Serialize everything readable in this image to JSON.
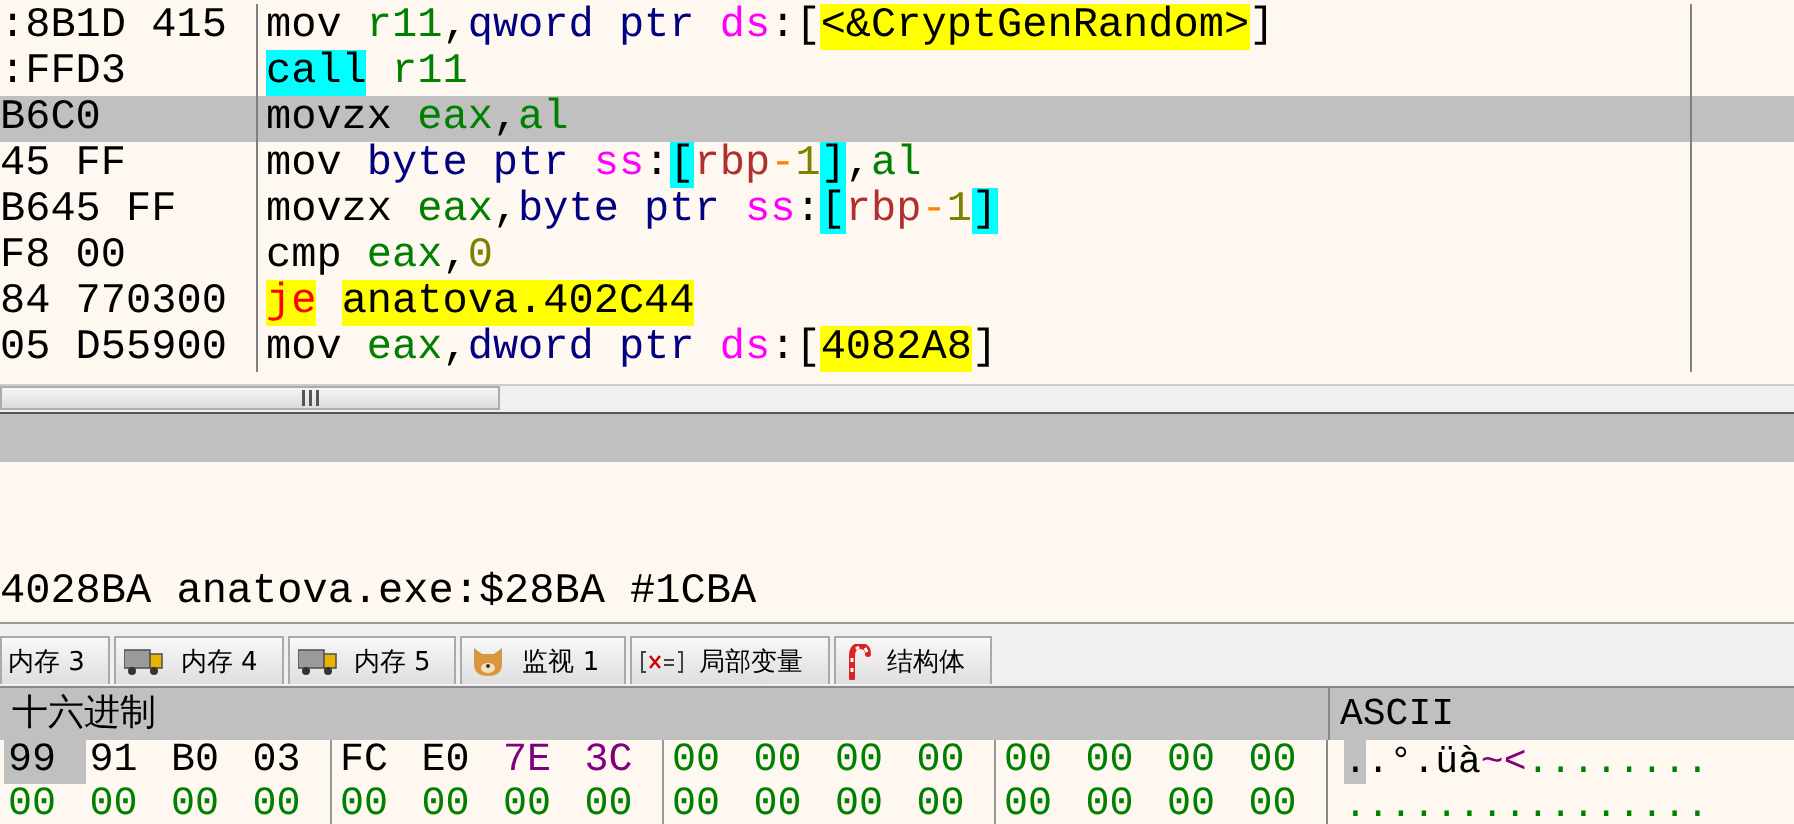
{
  "disassembly": {
    "rows": [
      {
        "bytes": ":8B1D 415",
        "selected": false,
        "instruction": [
          {
            "text": "mov ",
            "kind": "mnem"
          },
          {
            "text": "r11",
            "kind": "reg"
          },
          {
            "text": ",",
            "kind": "punct"
          },
          {
            "text": "qword ptr ",
            "kind": "size"
          },
          {
            "text": "ds",
            "kind": "seg"
          },
          {
            "text": ":",
            "kind": "punct"
          },
          {
            "text": "[",
            "kind": "punct"
          },
          {
            "text": "<&CryptGenRandom>",
            "kind": "addr",
            "highlighted": true
          },
          {
            "text": "]",
            "kind": "punct"
          }
        ]
      },
      {
        "bytes": ":FFD3",
        "selected": false,
        "instruction": [
          {
            "text": "call",
            "kind": "mnem",
            "highlighted": true
          },
          {
            "text": " r11",
            "kind": "reg"
          }
        ]
      },
      {
        "bytes": "B6C0",
        "selected": true,
        "instruction": [
          {
            "text": "movzx ",
            "kind": "mnem"
          },
          {
            "text": "eax",
            "kind": "reg"
          },
          {
            "text": ",",
            "kind": "punct"
          },
          {
            "text": "al",
            "kind": "reg"
          }
        ]
      },
      {
        "bytes": "45 FF",
        "selected": false,
        "instruction": [
          {
            "text": "mov ",
            "kind": "mnem"
          },
          {
            "text": "byte ptr ",
            "kind": "size"
          },
          {
            "text": "ss",
            "kind": "seg"
          },
          {
            "text": ":",
            "kind": "punct"
          },
          {
            "text": "[",
            "kind": "punct",
            "highlighted": true
          },
          {
            "text": "rbp",
            "kind": "base"
          },
          {
            "text": "-",
            "kind": "op"
          },
          {
            "text": "1",
            "kind": "num"
          },
          {
            "text": "]",
            "kind": "punct",
            "highlighted": true
          },
          {
            "text": ",",
            "kind": "punct"
          },
          {
            "text": "al",
            "kind": "reg"
          }
        ]
      },
      {
        "bytes": "B645 FF",
        "selected": false,
        "instruction": [
          {
            "text": "movzx ",
            "kind": "mnem"
          },
          {
            "text": "eax",
            "kind": "reg"
          },
          {
            "text": ",",
            "kind": "punct"
          },
          {
            "text": "byte ptr ",
            "kind": "size"
          },
          {
            "text": "ss",
            "kind": "seg"
          },
          {
            "text": ":",
            "kind": "punct"
          },
          {
            "text": "[",
            "kind": "punct",
            "highlighted": true
          },
          {
            "text": "rbp",
            "kind": "base"
          },
          {
            "text": "-",
            "kind": "op"
          },
          {
            "text": "1",
            "kind": "num"
          },
          {
            "text": "]",
            "kind": "punct",
            "highlighted": true
          }
        ]
      },
      {
        "bytes": "F8 00",
        "selected": false,
        "instruction": [
          {
            "text": "cmp ",
            "kind": "mnem"
          },
          {
            "text": "eax",
            "kind": "reg"
          },
          {
            "text": ",",
            "kind": "punct"
          },
          {
            "text": "0",
            "kind": "num"
          }
        ]
      },
      {
        "bytes": "84 770300",
        "selected": false,
        "instruction": [
          {
            "text": "je",
            "kind": "jump",
            "highlighted": true
          },
          {
            "text": " anatova.402C44",
            "kind": "addr",
            "highlighted": true
          }
        ]
      },
      {
        "bytes": "05 D55900",
        "selected": false,
        "instruction": [
          {
            "text": "mov ",
            "kind": "mnem"
          },
          {
            "text": "eax",
            "kind": "reg"
          },
          {
            "text": ",",
            "kind": "punct"
          },
          {
            "text": "dword ptr ",
            "kind": "size"
          },
          {
            "text": "ds",
            "kind": "seg"
          },
          {
            "text": ":",
            "kind": "punct"
          },
          {
            "text": "[",
            "kind": "punct"
          },
          {
            "text": "4082A8",
            "kind": "addr",
            "highlighted": true
          },
          {
            "text": "]",
            "kind": "punct"
          }
        ]
      }
    ]
  },
  "info": {
    "text": "4028BA anatova.exe:$28BA #1CBA"
  },
  "tabs": [
    {
      "label": "内存 3",
      "kind": "plain",
      "selected": false
    },
    {
      "label": "内存 4",
      "kind": "memory",
      "selected": false
    },
    {
      "label": "内存 5",
      "kind": "memory",
      "selected": false
    },
    {
      "label": "监视 1",
      "kind": "watch",
      "selected": false
    },
    {
      "label": "局部变量",
      "kind": "locals",
      "selected": false
    },
    {
      "label": "结构体",
      "kind": "struct",
      "selected": false
    }
  ],
  "dump": {
    "hex_header": "十六进制",
    "ascii_header": "ASCII",
    "rows": [
      {
        "bytes": [
          {
            "v": "99",
            "kind": "other",
            "selected": true
          },
          {
            "v": "91",
            "kind": "other",
            "selected": false
          },
          {
            "v": "B0",
            "kind": "other",
            "selected": false
          },
          {
            "v": "03",
            "kind": "other",
            "selected": false
          },
          {
            "v": "FC",
            "kind": "other",
            "selected": false
          },
          {
            "v": "E0",
            "kind": "other",
            "selected": false
          },
          {
            "v": "7E",
            "kind": "printable",
            "selected": false
          },
          {
            "v": "3C",
            "kind": "printable",
            "selected": false
          },
          {
            "v": "00",
            "kind": "zero",
            "selected": false
          },
          {
            "v": "00",
            "kind": "zero",
            "selected": false
          },
          {
            "v": "00",
            "kind": "zero",
            "selected": false
          },
          {
            "v": "00",
            "kind": "zero",
            "selected": false
          },
          {
            "v": "00",
            "kind": "zero",
            "selected": false
          },
          {
            "v": "00",
            "kind": "zero",
            "selected": false
          },
          {
            "v": "00",
            "kind": "zero",
            "selected": false
          },
          {
            "v": "00",
            "kind": "zero",
            "selected": false
          }
        ],
        "ascii": [
          {
            "text": ".",
            "kind": "other",
            "selected": true
          },
          {
            "text": ".°.üà",
            "kind": "other",
            "selected": false
          },
          {
            "text": "~<",
            "kind": "printable",
            "selected": false
          },
          {
            "text": "........",
            "kind": "zero",
            "selected": false
          }
        ]
      },
      {
        "bytes": [
          {
            "v": "00",
            "kind": "zero",
            "selected": false
          },
          {
            "v": "00",
            "kind": "zero",
            "selected": false
          },
          {
            "v": "00",
            "kind": "zero",
            "selected": false
          },
          {
            "v": "00",
            "kind": "zero",
            "selected": false
          },
          {
            "v": "00",
            "kind": "zero",
            "selected": false
          },
          {
            "v": "00",
            "kind": "zero",
            "selected": false
          },
          {
            "v": "00",
            "kind": "zero",
            "selected": false
          },
          {
            "v": "00",
            "kind": "zero",
            "selected": false
          },
          {
            "v": "00",
            "kind": "zero",
            "selected": false
          },
          {
            "v": "00",
            "kind": "zero",
            "selected": false
          },
          {
            "v": "00",
            "kind": "zero",
            "selected": false
          },
          {
            "v": "00",
            "kind": "zero",
            "selected": false
          },
          {
            "v": "00",
            "kind": "zero",
            "selected": false
          },
          {
            "v": "00",
            "kind": "zero",
            "selected": false
          },
          {
            "v": "00",
            "kind": "zero",
            "selected": false
          },
          {
            "v": "00",
            "kind": "zero",
            "selected": false
          }
        ],
        "ascii": [
          {
            "text": "................",
            "kind": "zero",
            "selected": false
          }
        ]
      }
    ]
  }
}
